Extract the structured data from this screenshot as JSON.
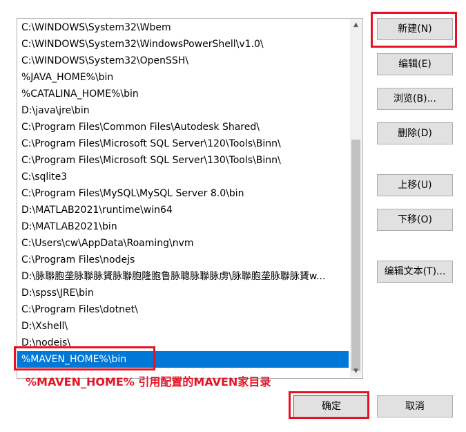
{
  "path_list": {
    "items": [
      "C:\\WINDOWS\\System32\\Wbem",
      "C:\\WINDOWS\\System32\\WindowsPowerShell\\v1.0\\",
      "C:\\WINDOWS\\System32\\OpenSSH\\",
      "%JAVA_HOME%\\bin",
      "%CATALINA_HOME%\\bin",
      "D:\\java\\jre\\bin",
      "C:\\Program Files\\Common Files\\Autodesk Shared\\",
      "C:\\Program Files\\Microsoft SQL Server\\120\\Tools\\Binn\\",
      "C:\\Program Files\\Microsoft SQL Server\\130\\Tools\\Binn\\",
      "C:\\sqlite3",
      "C:\\Program Files\\MySQL\\MySQL Server 8.0\\bin",
      "D:\\MATLAB2021\\runtime\\win64",
      "D:\\MATLAB2021\\bin",
      "C:\\Users\\cw\\AppData\\Roaming\\nvm",
      "C:\\Program Files\\nodejs",
      "D:\\脉聯胞垄脉聯脉贇脉聯胞隆胞鲁脉聰脉聯脉虏\\脉聯胞垄脉聯脉贇w...",
      "D:\\spss\\JRE\\bin",
      "C:\\Program Files\\dotnet\\",
      "D:\\Xshell\\",
      "D:\\nodejs\\",
      "%MAVEN_HOME%\\bin"
    ],
    "selected_index": 20
  },
  "buttons": {
    "new": "新建(N)",
    "edit": "编辑(E)",
    "browse": "浏览(B)...",
    "delete": "删除(D)",
    "move_up": "上移(U)",
    "move_down": "下移(O)",
    "edit_text": "编辑文本(T)...",
    "ok": "确定",
    "cancel": "取消"
  },
  "annotation": "%MAVEN_HOME% 引用配置的MAVEN家目录",
  "colors": {
    "selection": "#0078d7",
    "highlight_red": "#e81123"
  }
}
